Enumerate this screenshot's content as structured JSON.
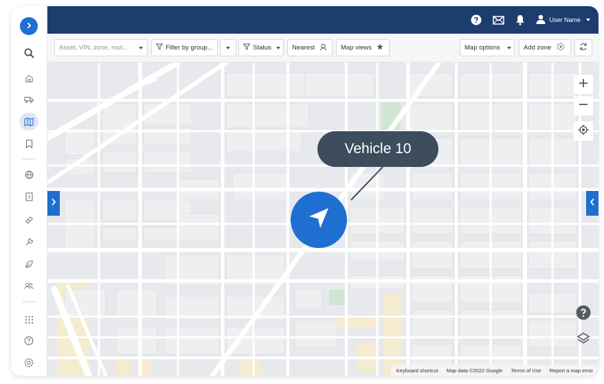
{
  "header": {
    "user_name": "User Name",
    "icons": [
      "help-icon",
      "mail-icon",
      "bell-icon",
      "user-icon"
    ]
  },
  "rail": {
    "items": [
      "expand-icon",
      "search-icon",
      "home-icon",
      "truck-icon",
      "map-icon",
      "bookmark-icon",
      "globe-icon",
      "report-icon",
      "fuel-icon",
      "wrench-icon",
      "leaf-icon",
      "people-icon",
      "apps-icon",
      "help-icon",
      "settings-icon"
    ],
    "active": "map-icon"
  },
  "toolbar": {
    "search_placeholder": "Asset, VIN, zone, rout...",
    "filter_label": "Filter by group...",
    "status_label": "Status",
    "nearest_label": "Nearest",
    "map_views_label": "Map views",
    "map_options_label": "Map options",
    "add_zone_label": "Add zone"
  },
  "map": {
    "vehicle_label": "Vehicle 10",
    "accent": "#1f6fd0",
    "label_bg": "#3d4d5e"
  },
  "footer": {
    "keyboard": "Keyboard shortcut",
    "mapdata": "Map data ©2022 Google",
    "terms": "Terms of Use",
    "report": "Report a map error"
  },
  "colors": {
    "header": "#1c3d6e",
    "accent": "#1f6fd0"
  }
}
